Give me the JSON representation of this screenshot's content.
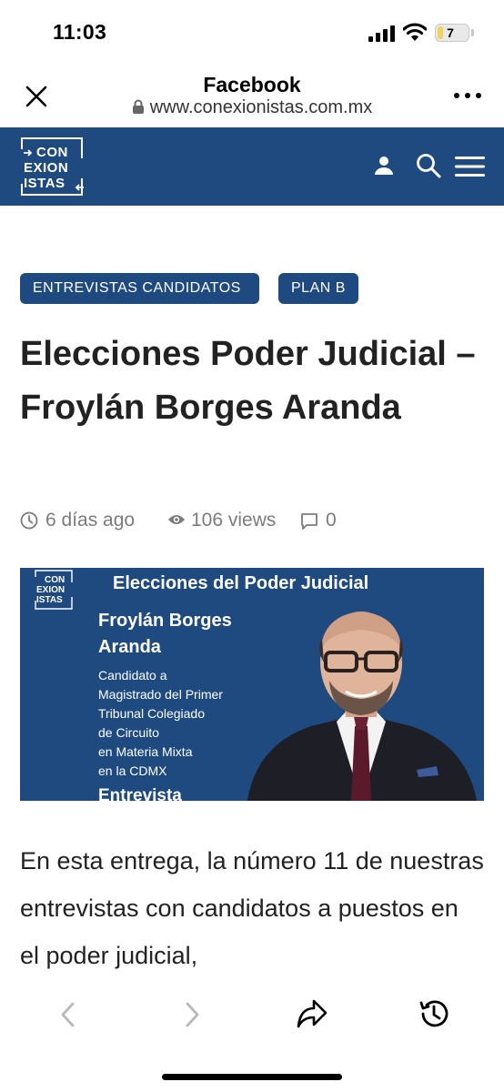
{
  "status_bar": {
    "time": "11:03",
    "battery_level": "7"
  },
  "browser": {
    "title": "Facebook",
    "url": "www.conexionistas.com.mx",
    "icons": [
      "close-icon",
      "lock-icon",
      "more-icon"
    ]
  },
  "site": {
    "logo_lines": [
      "CON",
      "EXION",
      "ISTAS"
    ],
    "icons": [
      "user-icon",
      "search-icon",
      "menu-icon"
    ],
    "brand_color": "#1e4a80"
  },
  "article": {
    "tags": [
      "ENTREVISTAS CANDIDATOS",
      "PLAN B"
    ],
    "title": "Elecciones Poder Judicial – Froylán Borges Aranda",
    "time_ago": "6 días ago",
    "views": "106 views",
    "comments": "0",
    "body": "En esta entrega, la número 11 de nuestras entrevistas con candidatos a puestos en el poder judicial,"
  },
  "feature_image": {
    "logo_lines": [
      "CON",
      "EXION",
      "ISTAS"
    ],
    "heading": "Elecciones del Poder Judicial",
    "name_line1": "Froylán Borges",
    "name_line2": "Aranda",
    "desc_lines": [
      "Candidato a",
      "Magistrado del Primer",
      "Tribunal Colegiado",
      "de Circuito",
      "en Materia Mixta",
      "en la CDMX"
    ],
    "footer": "Entrevista"
  },
  "toolbar": {
    "icons": [
      "back-icon",
      "forward-icon",
      "share-icon",
      "history-icon"
    ]
  }
}
